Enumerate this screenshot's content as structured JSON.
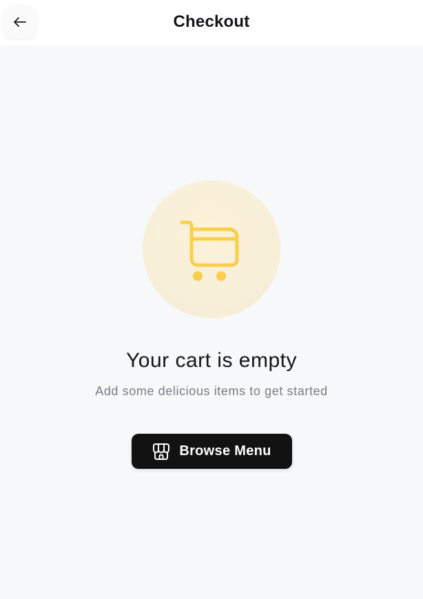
{
  "header": {
    "title": "Checkout",
    "back_icon": "arrow-left-icon"
  },
  "empty_state": {
    "icon": "shopping-cart-icon",
    "title": "Your cart is empty",
    "subtitle": "Add some delicious items to get started",
    "button_label": "Browse Menu",
    "button_icon": "store-icon"
  },
  "colors": {
    "accent": "#f9cf4a",
    "accent_bg": "#f8efd9",
    "button_bg": "#121212",
    "page_bg": "#f7f8fa"
  }
}
